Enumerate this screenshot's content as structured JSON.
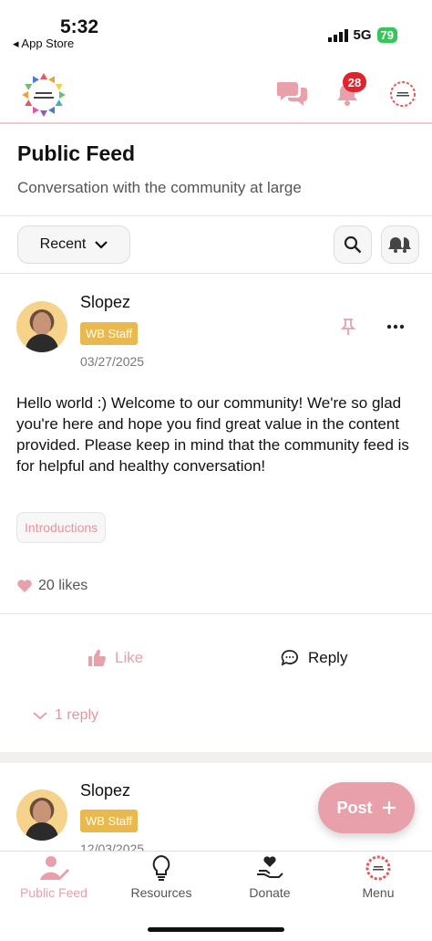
{
  "status_bar": {
    "time": "5:32",
    "back_label": "◂ App Store",
    "network": "5G",
    "battery": "79"
  },
  "header": {
    "notification_count": "28"
  },
  "page": {
    "title": "Public Feed",
    "subtitle": "Conversation with the community at large"
  },
  "toolbar": {
    "sort_label": "Recent"
  },
  "posts": [
    {
      "author": "Slopez",
      "badge": "WB Staff",
      "date": "03/27/2025",
      "body": "Hello world :) Welcome to our community! We're so glad you're here and hope you find great value in the content provided. Please keep in mind that the community feed is for helpful and healthy conversation!",
      "tag": "Introductions",
      "likes": "20 likes",
      "like_label": "Like",
      "reply_label": "Reply",
      "replies": "1 reply"
    },
    {
      "author": "Slopez",
      "badge": "WB Staff",
      "date": "12/03/2025"
    }
  ],
  "fab": {
    "label": "Post"
  },
  "bottom_nav": [
    {
      "label": "Public Feed",
      "icon": "user-edit-icon",
      "active": true
    },
    {
      "label": "Resources",
      "icon": "lightbulb-icon"
    },
    {
      "label": "Donate",
      "icon": "heart-hand-icon"
    },
    {
      "label": "Menu",
      "icon": "logo-icon"
    }
  ],
  "colors": {
    "accent": "#e8a0aa",
    "badge": "#e9b94f",
    "notification": "#e1232c"
  }
}
